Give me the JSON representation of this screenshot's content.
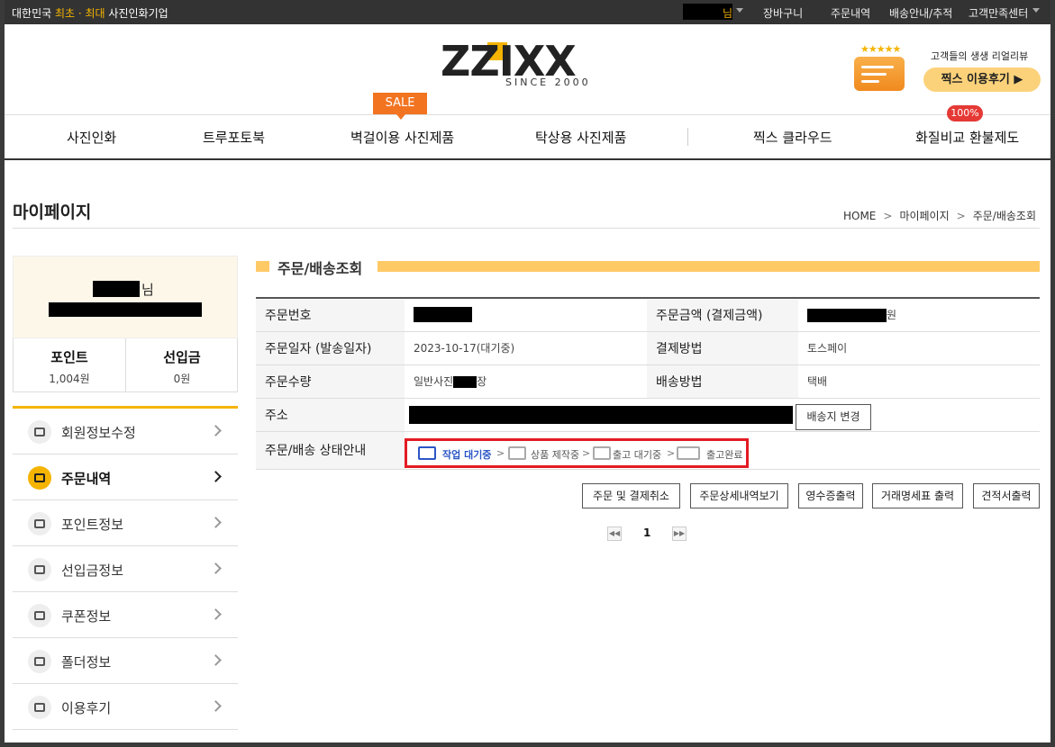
{
  "topbar": {
    "slogan_pre": "대한민국 ",
    "slogan_hl": "최초 · 최대",
    "slogan_post": " 사진인화기업",
    "user_suffix": "님",
    "links": [
      "장바구니",
      "주문내역",
      "배송안내/추적",
      "고객만족센터"
    ]
  },
  "logo": {
    "text": "ZZIXX",
    "since": "SINCE 2000"
  },
  "review": {
    "stars": "★★★★★",
    "text": "고객들의 생생 리얼리뷰",
    "button": "찍스 이용후기 ▶"
  },
  "gnb": {
    "items": [
      "사진인화",
      "트루포토북",
      "벽걸이용 사진제품",
      "탁상용 사진제품",
      "찍스 클라우드",
      "화질비교 환불제도"
    ],
    "sale_badge": "SALE",
    "pct_badge": "100%"
  },
  "page": {
    "title": "마이페이지",
    "breadcrumb": [
      "HOME",
      "마이페이지",
      "주문/배송조회"
    ]
  },
  "sidebar": {
    "user_suffix": "님",
    "points_label": "포인트",
    "points_value": "1,004원",
    "prepaid_label": "선입금",
    "prepaid_value": "0원",
    "menu": [
      {
        "label": "회원정보수정",
        "icon": "list-icon",
        "active": false
      },
      {
        "label": "주문내역",
        "icon": "basket-icon",
        "active": true
      },
      {
        "label": "포인트정보",
        "icon": "coins-icon",
        "active": false
      },
      {
        "label": "선입금정보",
        "icon": "wallet-icon",
        "active": false
      },
      {
        "label": "쿠폰정보",
        "icon": "coupon-icon",
        "active": false
      },
      {
        "label": "폴더정보",
        "icon": "folder-icon",
        "active": false
      },
      {
        "label": "이용후기",
        "icon": "comment-icon",
        "active": false
      }
    ]
  },
  "order": {
    "section_title": "주문/배송조회",
    "order_no_label": "주문번호",
    "amount_label": "주문금액 (결제금액)",
    "amount_suffix": "원",
    "date_label": "주문일자 (발송일자)",
    "date_value": "2023-10-17(대기중)",
    "pay_label": "결제방법",
    "pay_value": "토스페이",
    "qty_label": "주문수량",
    "qty_prefix": "일반사진",
    "qty_suffix": "장",
    "ship_label": "배송방법",
    "ship_value": "택배",
    "addr_label": "주소",
    "addr_button": "배송지 변경",
    "status_label": "주문/배송 상태안내",
    "steps": [
      "작업 대기중",
      "상품 제작중",
      "출고 대기중",
      "출고완료"
    ],
    "step_sep": ">"
  },
  "actions": [
    "주문 및 결제취소",
    "주문상세내역보기",
    "영수증출력",
    "거래명세표 출력",
    "견적서출력"
  ],
  "pager": {
    "prev": "◀◀",
    "current": "1",
    "next": "▶▶"
  }
}
